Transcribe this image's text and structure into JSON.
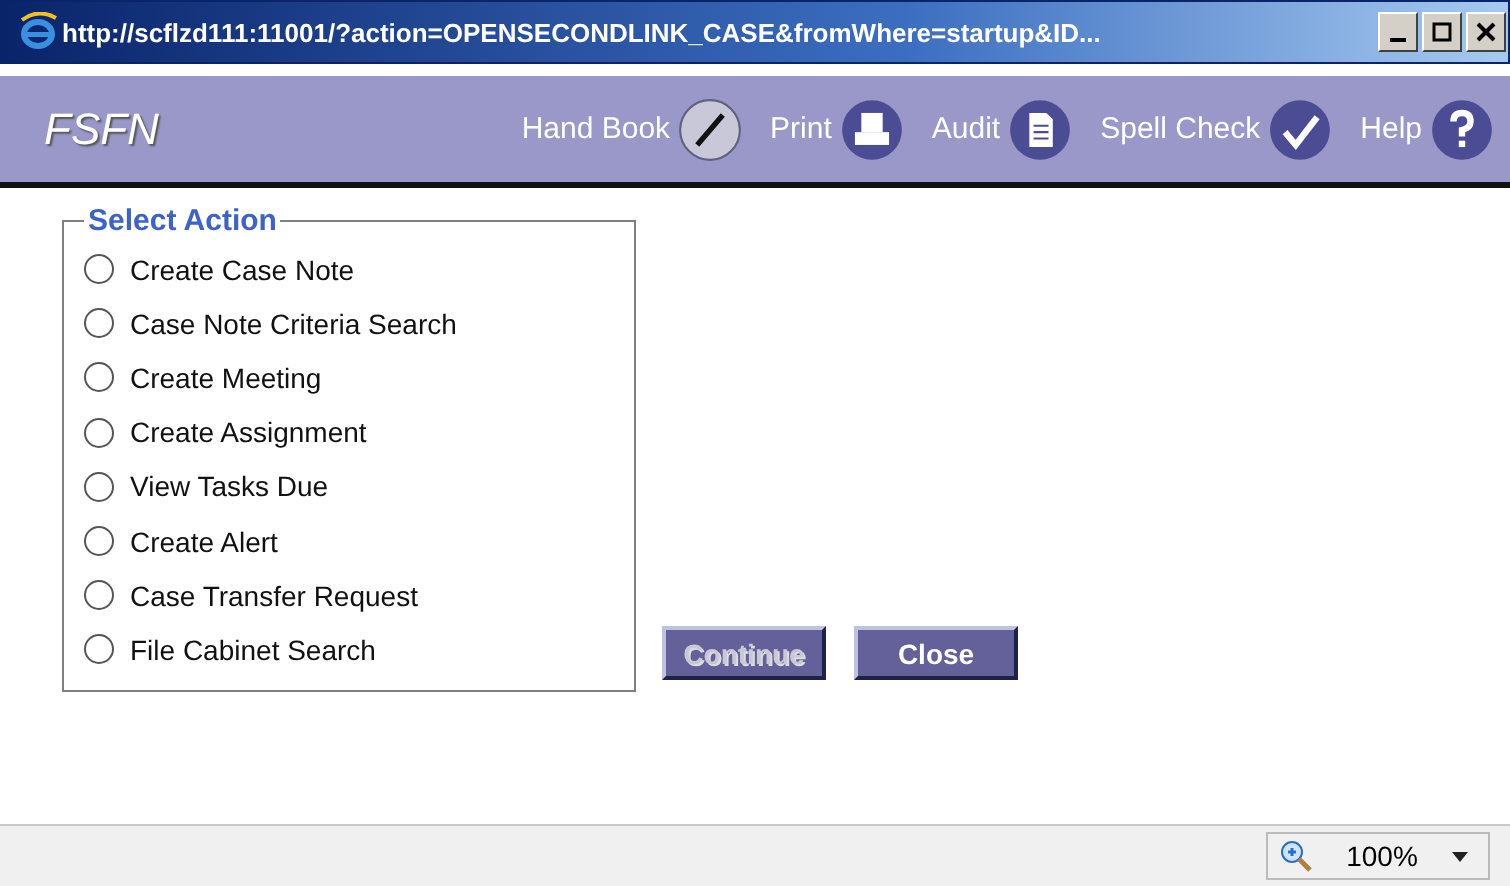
{
  "window": {
    "title": "http://scflzd111:11001/?action=OPENSECONDLINK_CASE&fromWhere=startup&ID..."
  },
  "toolbar": {
    "brand": "FSFN",
    "items": [
      {
        "label": "Hand Book",
        "kind": "pen"
      },
      {
        "label": "Print",
        "kind": "printer"
      },
      {
        "label": "Audit",
        "kind": "document"
      },
      {
        "label": "Spell Check",
        "kind": "spell"
      },
      {
        "label": "Help",
        "kind": "help"
      }
    ]
  },
  "select_action": {
    "legend": "Select Action",
    "options": [
      {
        "label": "Create Case Note",
        "selected": false
      },
      {
        "label": "Case Note Criteria Search",
        "selected": false
      },
      {
        "label": "Create Meeting",
        "selected": false
      },
      {
        "label": "Create Assignment",
        "selected": false
      },
      {
        "label": "View Tasks Due",
        "selected": false
      },
      {
        "label": "Create Alert",
        "selected": false
      },
      {
        "label": "Case Transfer Request",
        "selected": false
      },
      {
        "label": "File Cabinet Search",
        "selected": false
      }
    ]
  },
  "buttons": [
    {
      "label": "Continue",
      "disabled": true
    },
    {
      "label": "Close",
      "disabled": false
    }
  ],
  "status_bar": {
    "zoom": "100%"
  }
}
